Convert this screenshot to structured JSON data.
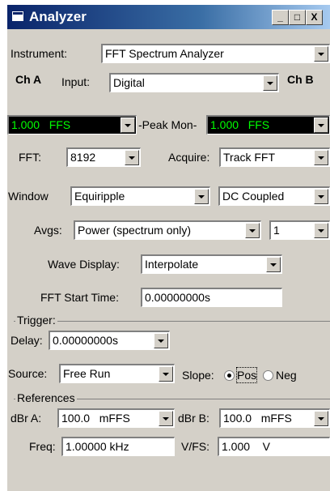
{
  "window": {
    "title": "Analyzer",
    "minimize_glyph": "_",
    "maximize_glyph": "□",
    "close_glyph": "X"
  },
  "instrument": {
    "label": "Instrument:",
    "value": "FFT Spectrum Analyzer"
  },
  "channels": {
    "ch_a_label": "Ch A",
    "ch_b_label": "Ch B",
    "input_label": "Input:",
    "input_value": "Digital"
  },
  "level": {
    "ch_a_value": "1.000   FFS",
    "peak_mon_label": "-Peak Mon-",
    "ch_b_value": "1.000   FFS"
  },
  "fft": {
    "label": "FFT:",
    "value": "8192",
    "acquire_label": "Acquire:",
    "acquire_value": "Track FFT"
  },
  "window_settings": {
    "label": "Window",
    "value": "Equiripple",
    "coupling_value": "DC Coupled"
  },
  "averages": {
    "label": "Avgs:",
    "value": "Power (spectrum only)",
    "count": "1"
  },
  "wave_display": {
    "label": "Wave Display:",
    "value": "Interpolate"
  },
  "fft_start": {
    "label": "FFT Start Time:",
    "value": "0.00000000s"
  },
  "trigger": {
    "group_label": "Trigger:",
    "delay_label": "Delay:",
    "delay_value": "0.00000000s",
    "source_label": "Source:",
    "source_value": "Free Run",
    "slope_label": "Slope:",
    "pos_label": "Pos",
    "neg_label": "Neg",
    "slope_selected": "Pos"
  },
  "references": {
    "group_label": "References",
    "dbr_a_label": "dBr A:",
    "dbr_a_value": "100.0   mFFS",
    "dbr_b_label": "dBr B:",
    "dbr_b_value": "100.0   mFFS",
    "freq_label": "Freq:",
    "freq_value": "1.00000 kHz",
    "vfs_label": "V/FS:",
    "vfs_value": "1.000    V"
  },
  "colors": {
    "title_bar": "#0a246a",
    "panel": "#d4d0c8",
    "level_display_bg": "#000000",
    "level_display_text": "#00ff00"
  }
}
